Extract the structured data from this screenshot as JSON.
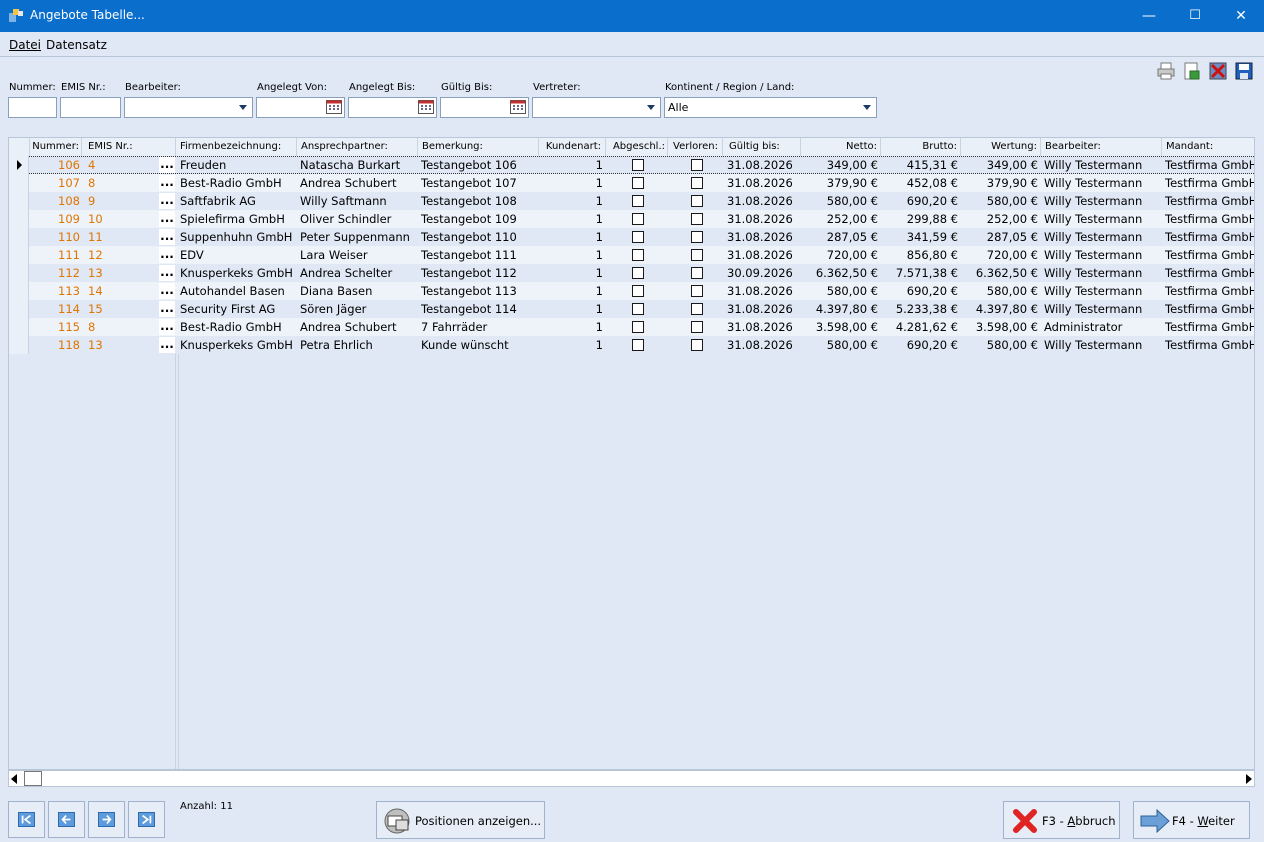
{
  "window": {
    "title": "Angebote Tabelle...",
    "minimize": "—",
    "maximize": "☐",
    "close": "✕"
  },
  "menu": {
    "items": [
      "Datei",
      "Datensatz"
    ]
  },
  "filters": {
    "nummer": {
      "label": "Nummer:",
      "value": ""
    },
    "emis": {
      "label": "EMIS Nr.:",
      "value": ""
    },
    "bearbeiter": {
      "label": "Bearbeiter:",
      "value": ""
    },
    "angelegt_von": {
      "label": "Angelegt Von:",
      "value": ""
    },
    "angelegt_bis": {
      "label": "Angelegt Bis:",
      "value": ""
    },
    "gueltig_bis": {
      "label": "Gültig Bis:",
      "value": ""
    },
    "vertreter": {
      "label": "Vertreter:",
      "value": ""
    },
    "kontinent": {
      "label": "Kontinent / Region / Land:",
      "value": "Alle"
    }
  },
  "grid": {
    "columns": [
      "Nummer:",
      "EMIS Nr.:",
      "Firmenbezeichnung:",
      "Ansprechpartner:",
      "Bemerkung:",
      "Kundenart:",
      "Abgeschl.:",
      "Verloren:",
      "Gültig bis:",
      "Netto:",
      "Brutto:",
      "Wertung:",
      "Bearbeiter:",
      "Mandant:"
    ],
    "ellipsis": "...",
    "rows": [
      {
        "nummer": "106",
        "emis": "4",
        "firma": "Freuden",
        "ansprech": "Natascha Burkart",
        "bemerkung": "Testangebot 106",
        "kundenart": "1",
        "gueltig": "31.08.2026",
        "netto": "349,00 €",
        "brutto": "415,31 €",
        "wertung": "349,00 €",
        "bearbeiter": "Willy Testermann",
        "mandant": "Testfirma GmbH"
      },
      {
        "nummer": "107",
        "emis": "8",
        "firma": "Best-Radio GmbH",
        "ansprech": "Andrea Schubert",
        "bemerkung": "Testangebot 107",
        "kundenart": "1",
        "gueltig": "31.08.2026",
        "netto": "379,90 €",
        "brutto": "452,08 €",
        "wertung": "379,90 €",
        "bearbeiter": "Willy Testermann",
        "mandant": "Testfirma GmbH"
      },
      {
        "nummer": "108",
        "emis": "9",
        "firma": "Saftfabrik AG",
        "ansprech": "Willy Saftmann",
        "bemerkung": "Testangebot 108",
        "kundenart": "1",
        "gueltig": "31.08.2026",
        "netto": "580,00 €",
        "brutto": "690,20 €",
        "wertung": "580,00 €",
        "bearbeiter": "Willy Testermann",
        "mandant": "Testfirma GmbH"
      },
      {
        "nummer": "109",
        "emis": "10",
        "firma": "Spielefirma GmbH",
        "ansprech": "Oliver Schindler",
        "bemerkung": "Testangebot 109",
        "kundenart": "1",
        "gueltig": "31.08.2026",
        "netto": "252,00 €",
        "brutto": "299,88 €",
        "wertung": "252,00 €",
        "bearbeiter": "Willy Testermann",
        "mandant": "Testfirma GmbH"
      },
      {
        "nummer": "110",
        "emis": "11",
        "firma": "Suppenhuhn GmbH",
        "ansprech": "Peter Suppenmann",
        "bemerkung": "Testangebot 110",
        "kundenart": "1",
        "gueltig": "31.08.2026",
        "netto": "287,05 €",
        "brutto": "341,59 €",
        "wertung": "287,05 €",
        "bearbeiter": "Willy Testermann",
        "mandant": "Testfirma GmbH"
      },
      {
        "nummer": "111",
        "emis": "12",
        "firma": "EDV",
        "ansprech": "Lara Weiser",
        "bemerkung": "Testangebot 111",
        "kundenart": "1",
        "gueltig": "31.08.2026",
        "netto": "720,00 €",
        "brutto": "856,80 €",
        "wertung": "720,00 €",
        "bearbeiter": "Willy Testermann",
        "mandant": "Testfirma GmbH"
      },
      {
        "nummer": "112",
        "emis": "13",
        "firma": "Knusperkeks GmbH",
        "ansprech": "Andrea Schelter",
        "bemerkung": "Testangebot 112",
        "kundenart": "1",
        "gueltig": "30.09.2026",
        "netto": "6.362,50 €",
        "brutto": "7.571,38 €",
        "wertung": "6.362,50 €",
        "bearbeiter": "Willy Testermann",
        "mandant": "Testfirma GmbH"
      },
      {
        "nummer": "113",
        "emis": "14",
        "firma": "Autohandel Basen",
        "ansprech": "Diana Basen",
        "bemerkung": "Testangebot 113",
        "kundenart": "1",
        "gueltig": "31.08.2026",
        "netto": "580,00 €",
        "brutto": "690,20 €",
        "wertung": "580,00 €",
        "bearbeiter": "Willy Testermann",
        "mandant": "Testfirma GmbH"
      },
      {
        "nummer": "114",
        "emis": "15",
        "firma": "Security First AG",
        "ansprech": "Sören Jäger",
        "bemerkung": "Testangebot 114",
        "kundenart": "1",
        "gueltig": "31.08.2026",
        "netto": "4.397,80 €",
        "brutto": "5.233,38 €",
        "wertung": "4.397,80 €",
        "bearbeiter": "Willy Testermann",
        "mandant": "Testfirma GmbH"
      },
      {
        "nummer": "115",
        "emis": "8",
        "firma": "Best-Radio GmbH",
        "ansprech": "Andrea Schubert",
        "bemerkung": "7 Fahrräder",
        "kundenart": "1",
        "gueltig": "31.08.2026",
        "netto": "3.598,00 €",
        "brutto": "4.281,62 €",
        "wertung": "3.598,00 €",
        "bearbeiter": "Administrator",
        "mandant": "Testfirma GmbH"
      },
      {
        "nummer": "118",
        "emis": "13",
        "firma": "Knusperkeks GmbH",
        "ansprech": "Petra Ehrlich",
        "bemerkung": "Kunde wünscht",
        "kundenart": "1",
        "gueltig": "31.08.2026",
        "netto": "580,00 €",
        "brutto": "690,20 €",
        "wertung": "580,00 €",
        "bearbeiter": "Willy Testermann",
        "mandant": "Testfirma GmbH"
      }
    ]
  },
  "footer": {
    "count_label": "Anzahl: 11",
    "positions_button": "Positionen anzeigen...",
    "cancel_button_prefix": "F3 - ",
    "cancel_button_key": "A",
    "cancel_button_rest": "bbruch",
    "next_button_prefix": "F4 - ",
    "next_button_key": "W",
    "next_button_rest": "eiter"
  },
  "colors": {
    "titlebar": "#0a6fcc",
    "number_text": "#e07400",
    "background": "#dfe8f4"
  }
}
